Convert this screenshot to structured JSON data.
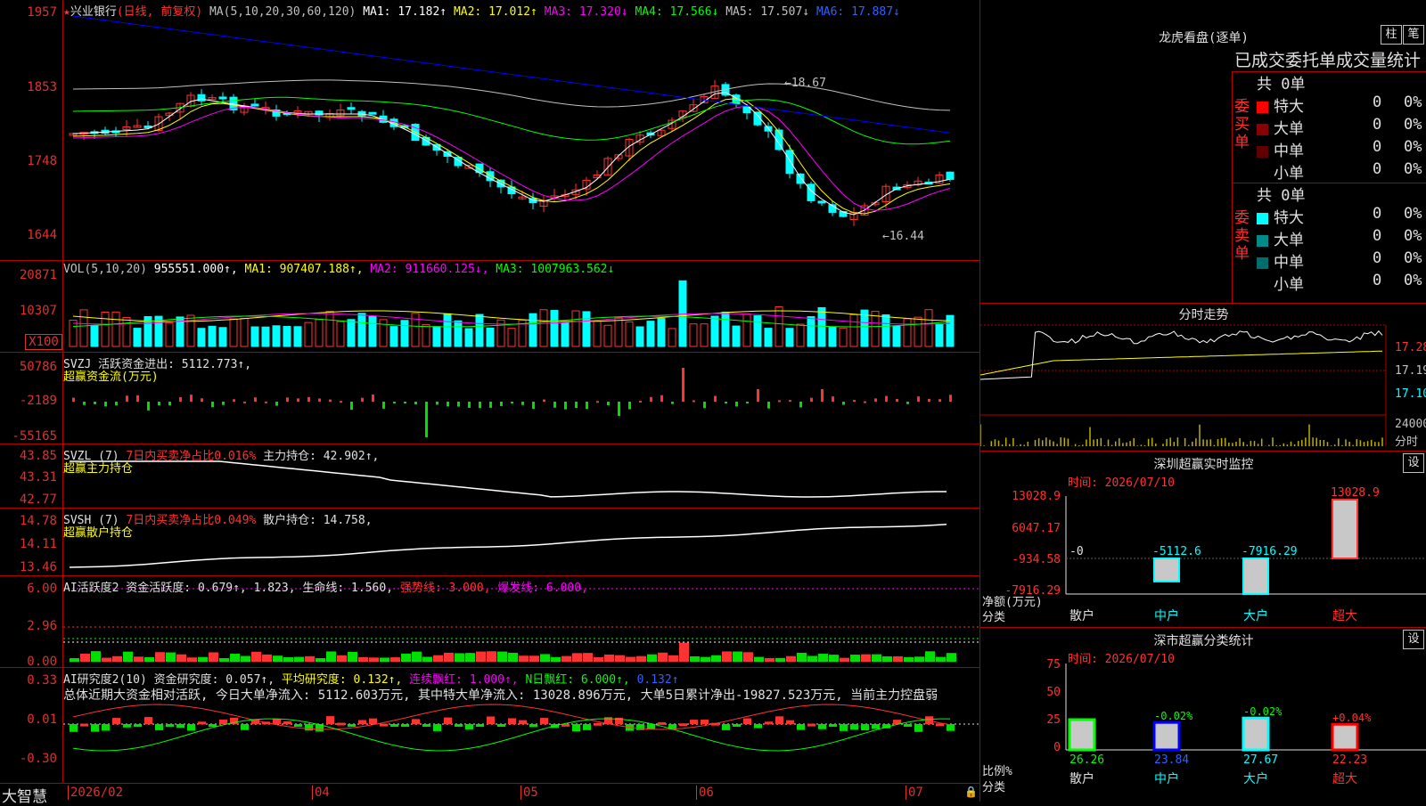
{
  "main": {
    "stock_name": "兴业银行",
    "mode": "(日线, 前复权)",
    "ma_label": "MA(5,10,20,30,60,120)",
    "ma1": "MA1: 17.182↑",
    "ma2": "MA2: 17.012↑",
    "ma3": "MA3: 17.320↓",
    "ma4": "MA4: 17.566↓",
    "ma5": "MA5: 17.507↓",
    "ma6": "MA6: 17.887↓",
    "yticks": [
      "1957",
      "1853",
      "1748",
      "1644"
    ],
    "high_mark": "←18.67",
    "low_mark": "←16.44"
  },
  "vol": {
    "label": "VOL(5,10,20)",
    "v": "955551.000↑,",
    "ma1": "MA1: 907407.188↑,",
    "ma2": "MA2: 911660.125↓,",
    "ma3": "MA3: 1007963.562↓",
    "yticks": [
      "20871",
      "10307",
      "X100"
    ]
  },
  "svzj": {
    "label": "SVZJ  活跃资金进出: 5112.773↑,",
    "sub": "超赢资金流(万元)",
    "yticks": [
      "50786",
      "-2189",
      "-55165"
    ]
  },
  "svzl": {
    "label_a": "SVZL (7)",
    "label_b": "7日内买卖净占比0.016%",
    "label_c": "主力持仓: 42.902↑,",
    "sub": "超赢主力持仓",
    "yticks": [
      "43.85",
      "43.31",
      "42.77"
    ]
  },
  "svsh": {
    "label_a": "SVSH (7)",
    "label_b": "7日内买卖净占比0.049%",
    "label_c": "散户持仓: 14.758,",
    "sub": "超赢散户持仓",
    "yticks": [
      "14.78",
      "14.11",
      "13.46"
    ]
  },
  "ai1": {
    "label_a": "AI活跃度2 资金活跃度: 0.679↑, 1.823, 生命线: 1.560,",
    "label_b": "强势线: 3.000,",
    "label_c": "爆发线: 6.000,",
    "yticks": [
      "6.00",
      "2.96",
      "0.00"
    ]
  },
  "ai2": {
    "label_a": "AI研究度2(10) 资金研究度: 0.057↑,",
    "label_b": "平均研究度: 0.132↑,",
    "label_c": "连续飘红: 1.000↑,",
    "label_d": "N日飘红: 6.000↑,",
    "label_e": "0.132↑",
    "summary": "总体近期大资金相对活跃, 今日大单净流入: 5112.603万元, 其中特大单净流入: 13028.896万元, 大单5日累计净出-19827.523万元, 当前主力控盘弱",
    "yticks": [
      "0.33",
      "0.01",
      "-0.30"
    ]
  },
  "xaxis": {
    "brand": "大智慧",
    "labels": [
      "2026/02",
      "04",
      "05",
      "06",
      "07"
    ]
  },
  "longhu": {
    "title": "龙虎看盘(逐单)",
    "btn1": "柱",
    "btn2": "笔",
    "subtitle": "已成交委托单成交量统计",
    "buy_total": "共 0单",
    "buy_side": "委买单",
    "sell_total": "共 0单",
    "sell_side": "委卖单",
    "buy_rows": [
      {
        "name": "特大",
        "count": "0",
        "pct": "0%",
        "color": "#ff0000"
      },
      {
        "name": "大单",
        "count": "0",
        "pct": "0%",
        "color": "#8b0000"
      },
      {
        "name": "中单",
        "count": "0",
        "pct": "0%",
        "color": "#600000"
      },
      {
        "name": "小单",
        "count": "0",
        "pct": "0%",
        "color": ""
      }
    ],
    "sell_rows": [
      {
        "name": "特大",
        "count": "0",
        "pct": "0%",
        "color": "#00ffff"
      },
      {
        "name": "大单",
        "count": "0",
        "pct": "0%",
        "color": "#008b8b"
      },
      {
        "name": "中单",
        "count": "0",
        "pct": "0%",
        "color": "#006d6d"
      },
      {
        "name": "小单",
        "count": "0",
        "pct": "0%",
        "color": ""
      }
    ]
  },
  "fenshi": {
    "title": "分时走势",
    "yticks": [
      "17.28",
      "17.19",
      "17.10"
    ],
    "vol_tick": "24000",
    "vol_label": "分时"
  },
  "monitor": {
    "title": "深圳超赢实时监控",
    "btn": "设",
    "time": "时间: 2026/07/10",
    "yticks": [
      "13028.9",
      "6047.17",
      "-934.58",
      "-7916.29"
    ],
    "ylabel": "净额(万元)",
    "xlabel": "分类",
    "categories": [
      "散户",
      "中户",
      "大户",
      "超大"
    ],
    "values": [
      0,
      -5112.6,
      -7916.29,
      13028.9
    ],
    "value_labels": [
      "-0",
      "-5112.6",
      "-7916.29",
      "13028.9"
    ]
  },
  "stats": {
    "title": "深市超赢分类统计",
    "btn": "设",
    "time": "时间: 2026/07/10",
    "yticks": [
      "75",
      "50",
      "25",
      "0"
    ],
    "ylabel": "比例%",
    "xlabel": "分类",
    "categories": [
      "散户",
      "中户",
      "大户",
      "超大"
    ],
    "values": [
      26.26,
      23.84,
      27.67,
      22.23
    ],
    "change_labels": [
      "",
      "-0.02%",
      "-0.02%",
      "+0.04%"
    ]
  },
  "colors": {
    "up": "#ff3232",
    "down": "#00ffff",
    "ma1": "#ffffff",
    "ma2": "#ffff00",
    "ma3": "#ff00ff",
    "ma4": "#00ff00",
    "ma5": "#c0c0c0",
    "ma6": "#0000ff"
  }
}
